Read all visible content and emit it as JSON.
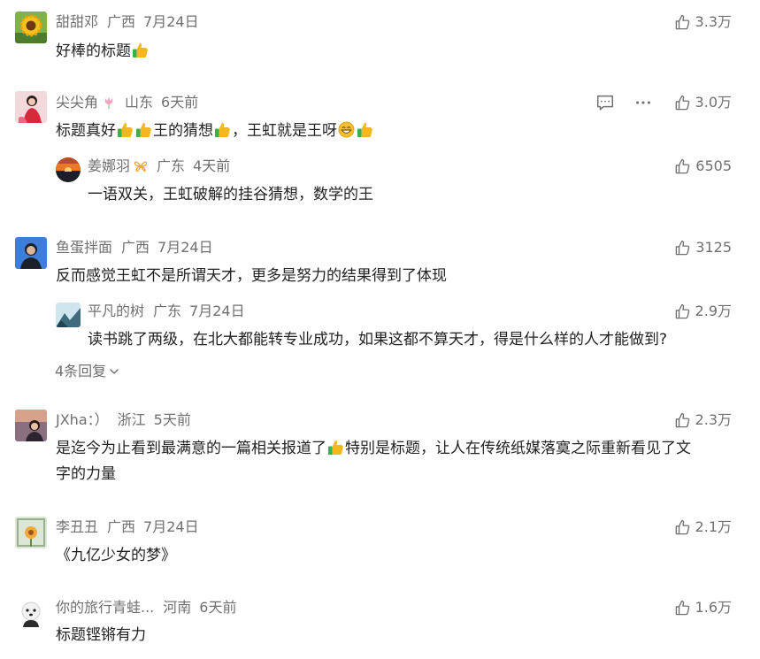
{
  "comments": [
    {
      "name": "甜甜邓",
      "location": "广西",
      "date": "7月24日",
      "text_parts": [
        "好棒的标题"
      ],
      "likes": "3.3万",
      "avatar_icon": "sunflower-avatar"
    },
    {
      "name": "尖尖角",
      "name_badge_icon": "tulip-icon",
      "location": "山东",
      "date": "6天前",
      "text_parts": [
        "标题真好",
        "王的猜想",
        "，王虹就是王呀"
      ],
      "likes": "3.0万",
      "avatar_icon": "woman-red-dress-avatar",
      "reply": {
        "name": "姜娜羽",
        "name_badge_icon": "butterfly-icon",
        "location": "广东",
        "date": "4天前",
        "text": "一语双关，王虹破解的挂谷猜想，数学的王",
        "likes": "6505",
        "avatar_icon": "sunset-avatar"
      }
    },
    {
      "name": "鱼蛋拌面",
      "location": "广西",
      "date": "7月24日",
      "text": "反而感觉王虹不是所谓天才，更多是努力的结果得到了体现",
      "likes": "3125",
      "avatar_icon": "blue-man-avatar",
      "reply": {
        "name": "平凡的树",
        "location": "广东",
        "date": "7月24日",
        "text": "读书跳了两级，在北大都能转专业成功，如果这都不算天才，得是什么样的人才能做到?",
        "likes": "2.9万",
        "avatar_icon": "landscape-avatar"
      },
      "more_replies_label": "4条回复"
    },
    {
      "name": "JXha：）",
      "location": "浙江",
      "date": "5天前",
      "text_line1_parts": [
        "是迄今为止看到最满意的一篇相关报道了",
        "特别是标题，让人在传统纸媒落寞之际重新看见了文"
      ],
      "text_line2": "字的力量",
      "likes": "2.3万",
      "avatar_icon": "girl-dusk-avatar"
    },
    {
      "name": "李丑丑",
      "location": "广西",
      "date": "7月24日",
      "text": "《九亿少女的梦》",
      "likes": "2.1万",
      "avatar_icon": "flower-window-avatar"
    },
    {
      "name": "你的旅行青蛙...",
      "location": "河南",
      "date": "6天前",
      "text": "标题铿锵有力",
      "likes": "1.6万",
      "avatar_icon": "white-dog-avatar"
    }
  ],
  "icons": {
    "like": "thumbs-up-icon",
    "reply": "comment-bubble-icon",
    "more": "more-dots-icon",
    "emoji_thumbs": "thumbs-up-emoji",
    "emoji_grin": "grinning-emoji",
    "chevron": "chevron-down-icon"
  },
  "colors": {
    "meta_text": "#707070",
    "body_text": "#222222",
    "emoji_yellow": "#F5B81C",
    "emoji_green": "#3DAE49"
  }
}
